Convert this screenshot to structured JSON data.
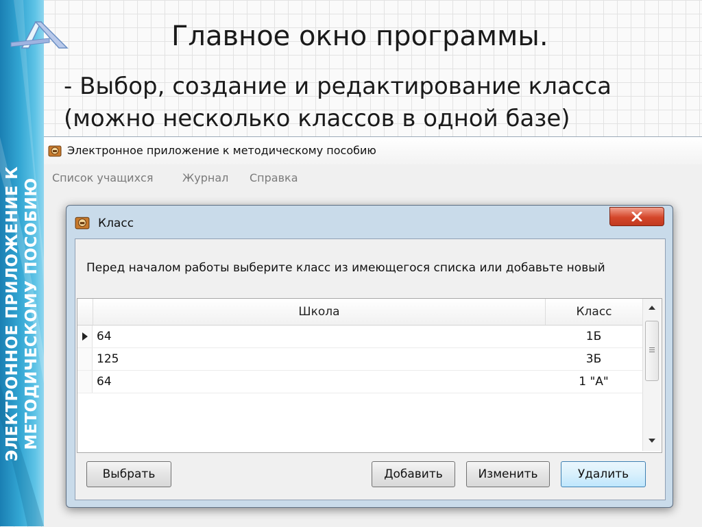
{
  "sidebar": {
    "vertical_text_line1": "ЭЛЕКТРОННОЕ ПРИЛОЖЕНИЕ К",
    "vertical_text_line2": "МЕТОДИЧЕСКОМУ ПОСОБИЮ"
  },
  "slide": {
    "title": "Главное окно программы.",
    "body_line1": "- Выбор, создание и редактирование класса",
    "body_line2": "(можно несколько классов в одной базе)"
  },
  "app": {
    "title": "Электронное приложение к методическому пособию",
    "menu": [
      "Список учащихся",
      "Журнал",
      "Справка"
    ]
  },
  "dialog": {
    "title": "Класс",
    "prompt": "Перед началом работы выберите класс из имеющегося списка или добавьте новый",
    "columns": {
      "school": "Школа",
      "class": "Класс"
    },
    "rows": [
      {
        "school": "64",
        "class": "1Б"
      },
      {
        "school": "125",
        "class": "3Б"
      },
      {
        "school": "64",
        "class": "1 \"А\""
      }
    ],
    "selected_row": 0,
    "buttons": {
      "select": "Выбрать",
      "add": "Добавить",
      "edit": "Изменить",
      "delete": "Удалить"
    }
  },
  "colors": {
    "sidebar": "#33a6d3",
    "close_button": "#d4462a",
    "primary_button_border": "#3c7fb1"
  }
}
